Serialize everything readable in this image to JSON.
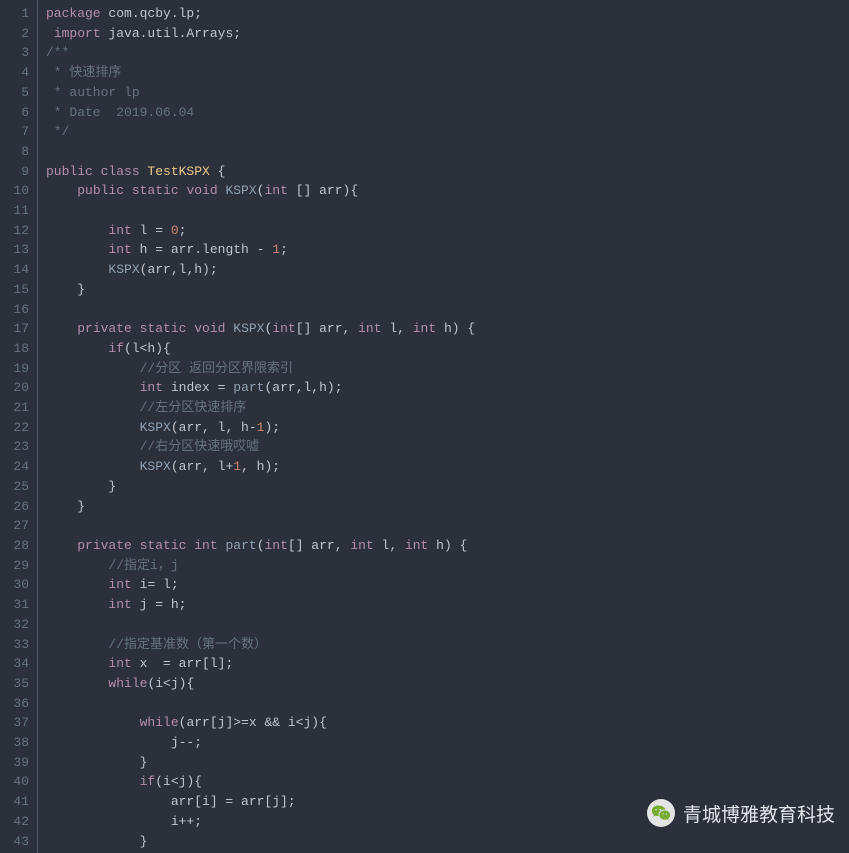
{
  "watermark": {
    "text": "青城博雅教育科技"
  },
  "code": {
    "lines": [
      {
        "n": 1,
        "tokens": [
          {
            "t": "package ",
            "c": "kw"
          },
          {
            "t": "com.qcby.lp",
            "c": "pkg"
          },
          {
            "t": ";",
            "c": "op"
          }
        ]
      },
      {
        "n": 2,
        "tokens": [
          {
            "t": " ",
            "c": ""
          },
          {
            "t": "import ",
            "c": "kw"
          },
          {
            "t": "java.util.Arrays",
            "c": "pkg"
          },
          {
            "t": ";",
            "c": "op"
          }
        ]
      },
      {
        "n": 3,
        "tokens": [
          {
            "t": "/**",
            "c": "cmt"
          }
        ]
      },
      {
        "n": 4,
        "tokens": [
          {
            "t": " * 快速排序",
            "c": "cmt"
          }
        ]
      },
      {
        "n": 5,
        "tokens": [
          {
            "t": " * author lp",
            "c": "cmt"
          }
        ]
      },
      {
        "n": 6,
        "tokens": [
          {
            "t": " * Date  2019.06.04",
            "c": "cmt"
          }
        ]
      },
      {
        "n": 7,
        "tokens": [
          {
            "t": " */",
            "c": "cmt"
          }
        ]
      },
      {
        "n": 8,
        "tokens": []
      },
      {
        "n": 9,
        "tokens": [
          {
            "t": "public class ",
            "c": "kw"
          },
          {
            "t": "TestKSPX ",
            "c": "type"
          },
          {
            "t": "{",
            "c": "op"
          }
        ]
      },
      {
        "n": 10,
        "tokens": [
          {
            "t": "    ",
            "c": ""
          },
          {
            "t": "public static ",
            "c": "kw"
          },
          {
            "t": "void ",
            "c": "kw"
          },
          {
            "t": "KSPX",
            "c": "fn"
          },
          {
            "t": "(",
            "c": "paren"
          },
          {
            "t": "int ",
            "c": "kw"
          },
          {
            "t": "[] arr",
            "c": "ident"
          },
          {
            "t": "){",
            "c": "op"
          }
        ]
      },
      {
        "n": 11,
        "tokens": []
      },
      {
        "n": 12,
        "tokens": [
          {
            "t": "        ",
            "c": ""
          },
          {
            "t": "int ",
            "c": "kw"
          },
          {
            "t": "l = ",
            "c": "ident"
          },
          {
            "t": "0",
            "c": "num"
          },
          {
            "t": ";",
            "c": "op"
          }
        ]
      },
      {
        "n": 13,
        "tokens": [
          {
            "t": "        ",
            "c": ""
          },
          {
            "t": "int ",
            "c": "kw"
          },
          {
            "t": "h = arr.length - ",
            "c": "ident"
          },
          {
            "t": "1",
            "c": "num"
          },
          {
            "t": ";",
            "c": "op"
          }
        ]
      },
      {
        "n": 14,
        "tokens": [
          {
            "t": "        ",
            "c": ""
          },
          {
            "t": "KSPX",
            "c": "fn"
          },
          {
            "t": "(arr,l,h);",
            "c": "ident"
          }
        ]
      },
      {
        "n": 15,
        "tokens": [
          {
            "t": "    }",
            "c": "op"
          }
        ]
      },
      {
        "n": 16,
        "tokens": []
      },
      {
        "n": 17,
        "tokens": [
          {
            "t": "    ",
            "c": ""
          },
          {
            "t": "private static ",
            "c": "kw"
          },
          {
            "t": "void ",
            "c": "kw"
          },
          {
            "t": "KSPX",
            "c": "fn"
          },
          {
            "t": "(",
            "c": "paren"
          },
          {
            "t": "int",
            "c": "kw"
          },
          {
            "t": "[] arr, ",
            "c": "ident"
          },
          {
            "t": "int ",
            "c": "kw"
          },
          {
            "t": "l, ",
            "c": "ident"
          },
          {
            "t": "int ",
            "c": "kw"
          },
          {
            "t": "h) {",
            "c": "ident"
          }
        ]
      },
      {
        "n": 18,
        "tokens": [
          {
            "t": "        ",
            "c": ""
          },
          {
            "t": "if",
            "c": "kw"
          },
          {
            "t": "(l<h){",
            "c": "ident"
          }
        ]
      },
      {
        "n": 19,
        "tokens": [
          {
            "t": "            ",
            "c": ""
          },
          {
            "t": "//分区 返回分区界限索引",
            "c": "cmt"
          }
        ]
      },
      {
        "n": 20,
        "tokens": [
          {
            "t": "            ",
            "c": ""
          },
          {
            "t": "int ",
            "c": "kw"
          },
          {
            "t": "index = ",
            "c": "ident"
          },
          {
            "t": "part",
            "c": "fn"
          },
          {
            "t": "(arr,l,h);",
            "c": "ident"
          }
        ]
      },
      {
        "n": 21,
        "tokens": [
          {
            "t": "            ",
            "c": ""
          },
          {
            "t": "//左分区快速排序",
            "c": "cmt"
          }
        ]
      },
      {
        "n": 22,
        "tokens": [
          {
            "t": "            ",
            "c": ""
          },
          {
            "t": "KSPX",
            "c": "fn"
          },
          {
            "t": "(arr, l, h-",
            "c": "ident"
          },
          {
            "t": "1",
            "c": "num"
          },
          {
            "t": ");",
            "c": "ident"
          }
        ]
      },
      {
        "n": 23,
        "tokens": [
          {
            "t": "            ",
            "c": ""
          },
          {
            "t": "//右分区快速哦哎嘘",
            "c": "cmt"
          }
        ]
      },
      {
        "n": 24,
        "tokens": [
          {
            "t": "            ",
            "c": ""
          },
          {
            "t": "KSPX",
            "c": "fn"
          },
          {
            "t": "(arr, l+",
            "c": "ident"
          },
          {
            "t": "1",
            "c": "num"
          },
          {
            "t": ", h);",
            "c": "ident"
          }
        ]
      },
      {
        "n": 25,
        "tokens": [
          {
            "t": "        }",
            "c": "op"
          }
        ]
      },
      {
        "n": 26,
        "tokens": [
          {
            "t": "    }",
            "c": "op"
          }
        ]
      },
      {
        "n": 27,
        "tokens": []
      },
      {
        "n": 28,
        "tokens": [
          {
            "t": "    ",
            "c": ""
          },
          {
            "t": "private static ",
            "c": "kw"
          },
          {
            "t": "int ",
            "c": "kw"
          },
          {
            "t": "part",
            "c": "fn"
          },
          {
            "t": "(",
            "c": "paren"
          },
          {
            "t": "int",
            "c": "kw"
          },
          {
            "t": "[] arr, ",
            "c": "ident"
          },
          {
            "t": "int ",
            "c": "kw"
          },
          {
            "t": "l, ",
            "c": "ident"
          },
          {
            "t": "int ",
            "c": "kw"
          },
          {
            "t": "h) {",
            "c": "ident"
          }
        ]
      },
      {
        "n": 29,
        "tokens": [
          {
            "t": "        ",
            "c": ""
          },
          {
            "t": "//指定i，j",
            "c": "cmt"
          }
        ]
      },
      {
        "n": 30,
        "tokens": [
          {
            "t": "        ",
            "c": ""
          },
          {
            "t": "int ",
            "c": "kw"
          },
          {
            "t": "i= l;",
            "c": "ident"
          }
        ]
      },
      {
        "n": 31,
        "tokens": [
          {
            "t": "        ",
            "c": ""
          },
          {
            "t": "int ",
            "c": "kw"
          },
          {
            "t": "j = h;",
            "c": "ident"
          }
        ]
      },
      {
        "n": 32,
        "tokens": []
      },
      {
        "n": 33,
        "tokens": [
          {
            "t": "        ",
            "c": ""
          },
          {
            "t": "//指定基准数（第一个数）",
            "c": "cmt"
          }
        ]
      },
      {
        "n": 34,
        "tokens": [
          {
            "t": "        ",
            "c": ""
          },
          {
            "t": "int ",
            "c": "kw"
          },
          {
            "t": "x  = arr[l];",
            "c": "ident"
          }
        ]
      },
      {
        "n": 35,
        "tokens": [
          {
            "t": "        ",
            "c": ""
          },
          {
            "t": "while",
            "c": "kw"
          },
          {
            "t": "(i<j){",
            "c": "ident"
          }
        ]
      },
      {
        "n": 36,
        "tokens": []
      },
      {
        "n": 37,
        "tokens": [
          {
            "t": "            ",
            "c": ""
          },
          {
            "t": "while",
            "c": "kw"
          },
          {
            "t": "(arr[j]>=x && i<j){",
            "c": "ident"
          }
        ]
      },
      {
        "n": 38,
        "tokens": [
          {
            "t": "                j--;",
            "c": "ident"
          }
        ]
      },
      {
        "n": 39,
        "tokens": [
          {
            "t": "            }",
            "c": "op"
          }
        ]
      },
      {
        "n": 40,
        "tokens": [
          {
            "t": "            ",
            "c": ""
          },
          {
            "t": "if",
            "c": "kw"
          },
          {
            "t": "(i<j){",
            "c": "ident"
          }
        ]
      },
      {
        "n": 41,
        "tokens": [
          {
            "t": "                arr[i] = arr[j];",
            "c": "ident"
          }
        ]
      },
      {
        "n": 42,
        "tokens": [
          {
            "t": "                i++;",
            "c": "ident"
          }
        ]
      },
      {
        "n": 43,
        "tokens": [
          {
            "t": "            }",
            "c": "op"
          }
        ]
      }
    ]
  }
}
